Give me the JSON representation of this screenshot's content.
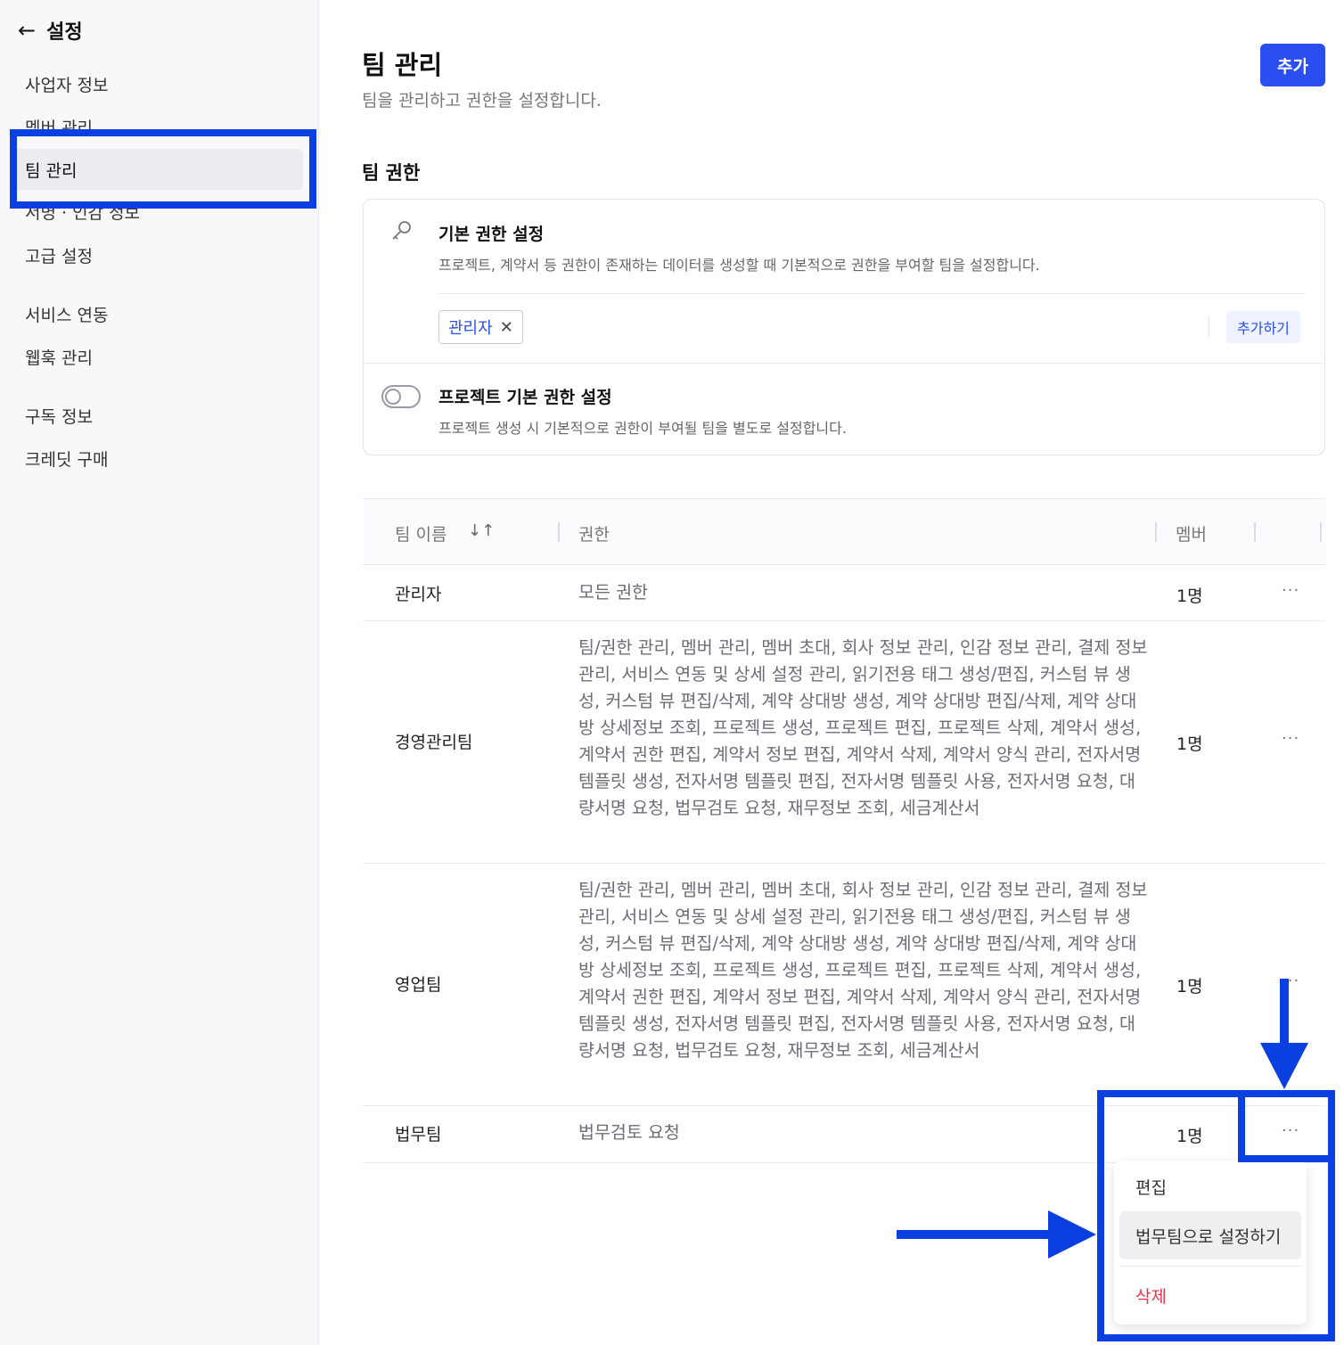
{
  "sidebar": {
    "title": "설정",
    "items": [
      "사업자 정보",
      "멤버 관리",
      "팀 관리",
      "서명 · 인감 정보",
      "고급 설정",
      "서비스 연동",
      "웹훅 관리",
      "구독 정보",
      "크레딧 구매"
    ],
    "active_item": "팀 관리"
  },
  "header": {
    "title": "팀 관리",
    "subtitle": "팀을 관리하고 권한을 설정합니다.",
    "add_button": "추가"
  },
  "permissions": {
    "section_title": "팀 권한",
    "default": {
      "title": "기본 권한 설정",
      "description": "프로젝트, 계약서 등 권한이 존재하는 데이터를 생성할 때 기본적으로 권한을 부여할 팀을 설정합니다.",
      "chip": "관리자",
      "add_link": "추가하기"
    },
    "project": {
      "title": "프로젝트 기본 권한 설정",
      "description": "프로젝트 생성 시 기본적으로 권한이 부여될 팀을 별도로 설정합니다.",
      "toggle_on": false
    }
  },
  "table": {
    "headers": [
      "팀 이름",
      "권한",
      "멤버"
    ],
    "rows": [
      {
        "name": "관리자",
        "permissions": "모든 권한",
        "members": "1명"
      },
      {
        "name": "경영관리팀",
        "permissions": "팀/권한 관리, 멤버 관리, 멤버 초대, 회사 정보 관리, 인감 정보 관리, 결제 정보 관리, 서비스 연동 및 상세 설정 관리, 읽기전용 태그 생성/편집, 커스텀 뷰 생성, 커스텀 뷰 편집/삭제, 계약 상대방 생성, 계약 상대방 편집/삭제, 계약 상대방 상세정보 조회, 프로젝트 생성, 프로젝트 편집, 프로젝트 삭제, 계약서 생성, 계약서 권한 편집, 계약서 정보 편집, 계약서 삭제, 계약서 양식 관리, 전자서명 템플릿 생성, 전자서명 템플릿 편집, 전자서명 템플릿 사용, 전자서명 요청, 대량서명 요청, 법무검토 요청, 재무정보 조회, 세금계산서",
        "members": "1명"
      },
      {
        "name": "영업팀",
        "permissions": "팀/권한 관리, 멤버 관리, 멤버 초대, 회사 정보 관리, 인감 정보 관리, 결제 정보 관리, 서비스 연동 및 상세 설정 관리, 읽기전용 태그 생성/편집, 커스텀 뷰 생성, 커스텀 뷰 편집/삭제, 계약 상대방 생성, 계약 상대방 편집/삭제, 계약 상대방 상세정보 조회, 프로젝트 생성, 프로젝트 편집, 프로젝트 삭제, 계약서 생성, 계약서 권한 편집, 계약서 정보 편집, 계약서 삭제, 계약서 양식 관리, 전자서명 템플릿 생성, 전자서명 템플릿 편집, 전자서명 템플릿 사용, 전자서명 요청, 대량서명 요청, 법무검토 요청, 재무정보 조회, 세금계산서",
        "members": "1명"
      },
      {
        "name": "법무팀",
        "permissions": "법무검토 요청",
        "members": "1명"
      }
    ],
    "more_glyph": "···"
  },
  "menu": {
    "items": [
      "편집",
      "법무팀으로 설정하기",
      "삭제"
    ]
  },
  "colors": {
    "accent": "#2b4ef0",
    "annotation": "#0a3fe0",
    "danger": "#e53950"
  }
}
